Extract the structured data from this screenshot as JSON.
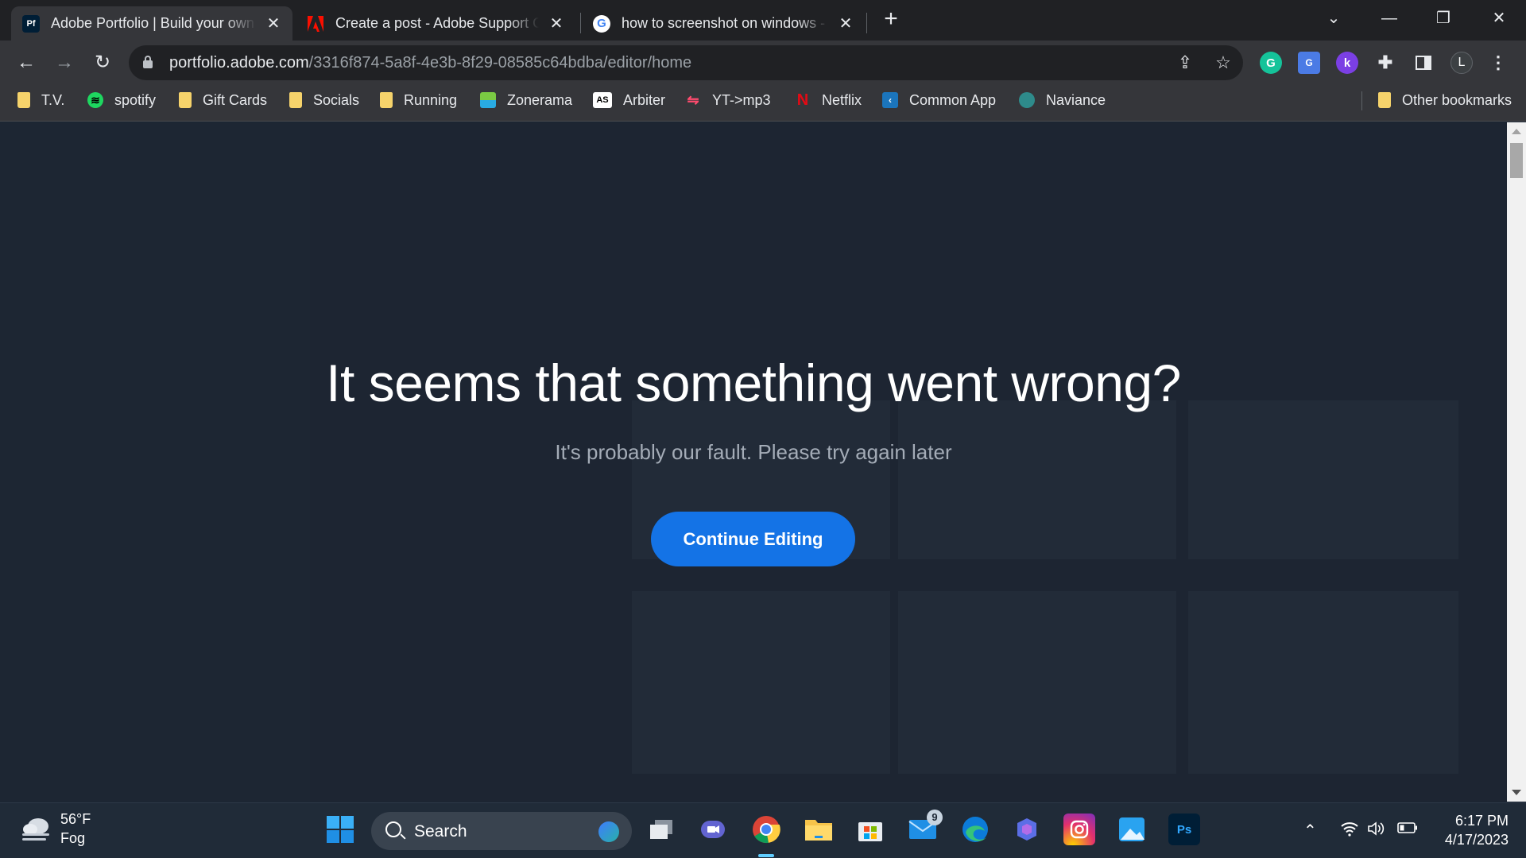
{
  "browser": {
    "tabs": [
      {
        "title": "Adobe Portfolio | Build your own",
        "favicon": "Pf",
        "active": true
      },
      {
        "title": "Create a post - Adobe Support Co",
        "favicon": "adobe",
        "active": false
      },
      {
        "title": "how to screenshot on windows - ",
        "favicon": "G",
        "active": false
      }
    ],
    "url_host": "portfolio.adobe.com",
    "url_path": "/3316f874-5a8f-4e3b-8f29-08585c64bdba/editor/home",
    "profile_initial": "L"
  },
  "bookmarks": {
    "items": [
      {
        "label": "T.V.",
        "icon": "folder-icon"
      },
      {
        "label": "spotify",
        "icon": "spotify-icon"
      },
      {
        "label": "Gift Cards",
        "icon": "folder-icon"
      },
      {
        "label": "Socials",
        "icon": "folder-icon"
      },
      {
        "label": "Running",
        "icon": "folder-icon"
      },
      {
        "label": "Zonerama",
        "icon": "zonerama-icon"
      },
      {
        "label": "Arbiter",
        "icon": "arbiter-icon"
      },
      {
        "label": "YT->mp3",
        "icon": "ytmp3-icon"
      },
      {
        "label": "Netflix",
        "icon": "netflix-icon"
      },
      {
        "label": "Common App",
        "icon": "commonapp-icon"
      },
      {
        "label": "Naviance",
        "icon": "naviance-icon"
      }
    ],
    "other": "Other bookmarks"
  },
  "error": {
    "title": "It seems that something went wrong?",
    "subtitle": "It's probably our fault. Please try again later",
    "button": "Continue Editing"
  },
  "taskbar": {
    "weather_temp": "56°F",
    "weather_desc": "Fog",
    "search_label": "Search",
    "mail_badge": "9",
    "time": "6:17 PM",
    "date": "4/17/2023"
  },
  "colors": {
    "accent": "#1473e6",
    "page_bg": "#1d2532",
    "taskbar_bg": "#202b38"
  }
}
